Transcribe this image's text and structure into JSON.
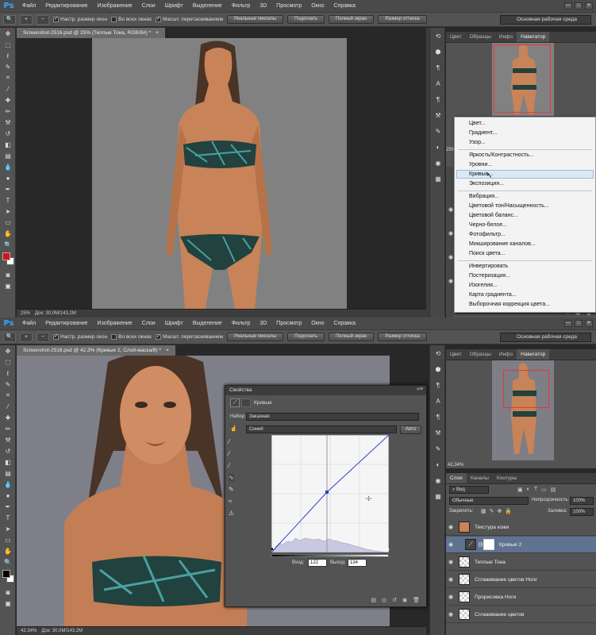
{
  "app_logo": "Ps",
  "menu": [
    "Файл",
    "Редактирование",
    "Изображение",
    "Слои",
    "Шрифт",
    "Выделение",
    "Фильтр",
    "3D",
    "Просмотр",
    "Окно",
    "Справка"
  ],
  "window_controls": [
    "—",
    "□",
    "✕"
  ],
  "options": {
    "chk_resize": "Настр. размер окон",
    "chk_all": "Во всех окнах",
    "chk_scrubby": "Масшт. перетаскиванием",
    "btn_actual": "Реальные пикселы",
    "btn_fit": "Подогнать",
    "btn_full": "Полный экран",
    "btn_print": "Размер оттиска",
    "workspace": "Основная рабочая среда"
  },
  "top": {
    "doc_tab": "Screenshot-2516.psd @ 25% (Теплые Тона, RGB/8#) *",
    "zoom": "25%",
    "doc_size": "Док: 30,0M/143,2M",
    "panel_tabs": [
      "Цвет",
      "Образцы",
      "Инфо",
      "Навигатор"
    ],
    "side_zoom": "25%",
    "context_menu": [
      "Цвет...",
      "Градиент...",
      "Узор...",
      "Яркость/Контрастность...",
      "Уровни...",
      "Кривые...",
      "Экспозиция...",
      "Вибрация...",
      "Цветовой тон/Насыщенность...",
      "Цветовой баланс...",
      "Черно-белое...",
      "Фотофильтр...",
      "Микширование каналов...",
      "Поиск цвета...",
      "Инвертировать",
      "Постеризация...",
      "Изогелия...",
      "Карта градиента...",
      "Выборочная коррекция цвета..."
    ],
    "highlighted": "Кривые..."
  },
  "bottom": {
    "doc_tab": "Screenshot-2516.psd @ 42,3% (Кривые 2, Слой-маска/8) *",
    "zoom": "42,34%",
    "doc_size": "Док: 30,0M/143,2M",
    "panel_tabs": [
      "Цвет",
      "Образцы",
      "Инфо",
      "Навигатор"
    ],
    "nav_zoom": "42,34%",
    "layer_tabs": [
      "Слои",
      "Каналы",
      "Контуры"
    ],
    "kind": "Вид",
    "blend_mode": "Обычные",
    "opacity_label": "Непрозрачность:",
    "opacity": "100%",
    "lock_label": "Закрепить:",
    "fill_label": "Заливка:",
    "fill": "100%",
    "layers": [
      "Текстура кожи",
      "Кривые 2",
      "Теплые Тона",
      "Сглаживание цветов Ноги",
      "Прорисовка Ноги",
      "Сглаживание цветов"
    ],
    "properties": {
      "title": "Свойства",
      "type": "Кривые",
      "preset_label": "Набор:",
      "preset": "Заказная",
      "channel": "Синий",
      "auto": "Авто",
      "input_label": "Вход:",
      "input": "122",
      "output_label": "Выход:",
      "output": "134"
    }
  },
  "colors": {
    "foreground": "#e01010",
    "background": "#ffffff",
    "blue_curve": "#2a3fd0",
    "selection": "#dce8f5"
  }
}
